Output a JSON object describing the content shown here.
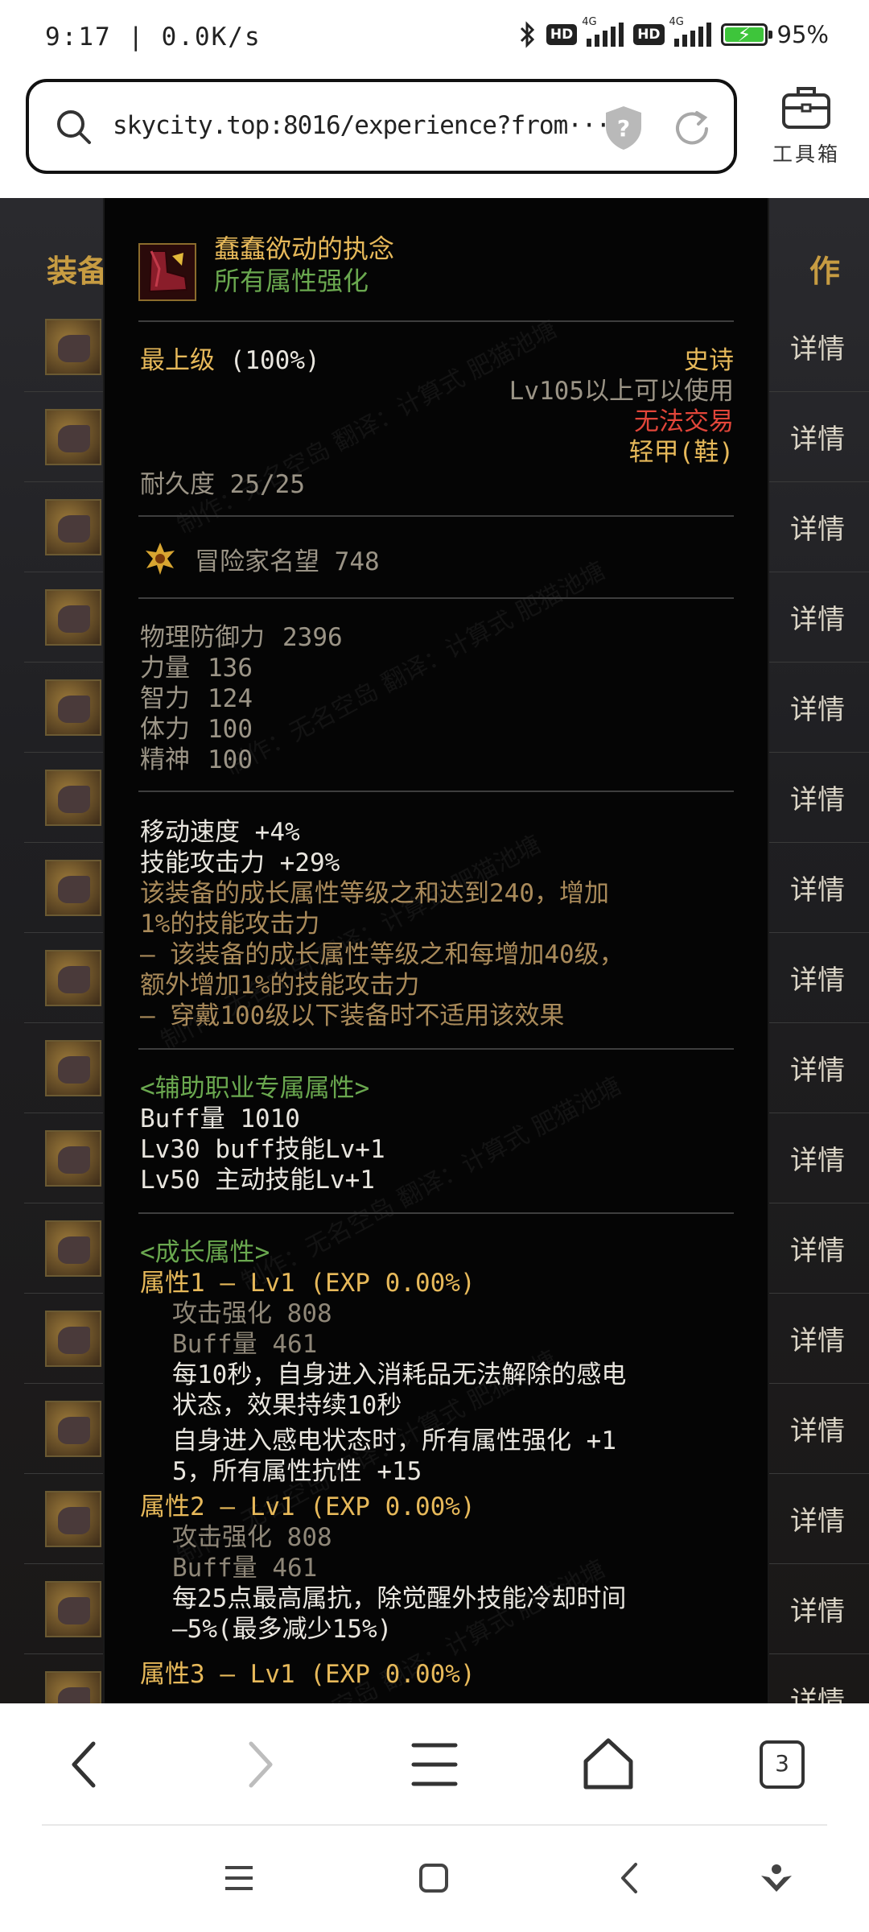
{
  "status_bar": {
    "time": "9:17",
    "network_speed": "0.0K/s",
    "hd_label": "HD",
    "net_type": "4G",
    "battery": "95%"
  },
  "url_bar": {
    "url": "skycity.top:8016/experience?from···",
    "toolbox_label": "工具箱"
  },
  "background": {
    "left_heading": "装备",
    "right_heading": "作",
    "detail_label": "详情"
  },
  "tooltip": {
    "name": "蠢蠢欲动的执念",
    "subtitle": "所有属性强化",
    "grade_label": "最上级",
    "grade_pct": "(100%)",
    "rarity": "史诗",
    "level_req": "Lv105以上可以使用",
    "trade": "无法交易",
    "type": "轻甲(鞋)",
    "durability": "耐久度 25/25",
    "fame": "冒险家名望 748",
    "stats": [
      {
        "name": "物理防御力",
        "value": "2396"
      },
      {
        "name": "力量",
        "value": "136"
      },
      {
        "name": "智力",
        "value": "124"
      },
      {
        "name": "体力",
        "value": "100"
      },
      {
        "name": "精神",
        "value": "100"
      }
    ],
    "effects": {
      "move_speed": "移动速度 +4%",
      "skill_attack": "技能攻击力 +29%",
      "desc1": "该装备的成长属性等级之和达到240，增加",
      "desc2": "1%的技能攻击力",
      "desc3": "— 该装备的成长属性等级之和每增加40级，",
      "desc4": "额外增加1%的技能攻击力",
      "desc5": "— 穿戴100级以下装备时不适用该效果"
    },
    "support": {
      "header": "<辅助职业专属属性>",
      "buff": "Buff量 1010",
      "line1": "Lv30 buff技能Lv+1",
      "line2": "Lv50 主动技能Lv+1"
    },
    "growth": {
      "header": "<成长属性>",
      "attr1_title": "属性1 — Lv1 (EXP 0.00%)",
      "attr1_atk": "攻击强化 808",
      "attr1_buff": "Buff量 461",
      "attr1_e1": "每10秒，自身进入消耗品无法解除的感电",
      "attr1_e2": "状态，效果持续10秒",
      "attr1_e3": "自身进入感电状态时，所有属性强化 +1",
      "attr1_e4": "5，所有属性抗性 +15",
      "attr2_title": "属性2 — Lv1 (EXP 0.00%)",
      "attr2_atk": "攻击强化 808",
      "attr2_buff": "Buff量 461",
      "attr2_e1": "每25点最高属抗，除觉醒外技能冷却时间",
      "attr2_e2": "—5%(最多减少15%)",
      "attr3_title": "属性3 — Lv1 (EXP 0.00%)"
    },
    "watermark": "制作：无名空岛 翻译：计算式 肥猫池塘"
  },
  "nav": {
    "tabs_count": "3"
  },
  "colors": {
    "gold": "#e7b95a",
    "green": "#6aa84f",
    "red": "#e2463a",
    "tooltip_bg": "#050505"
  }
}
